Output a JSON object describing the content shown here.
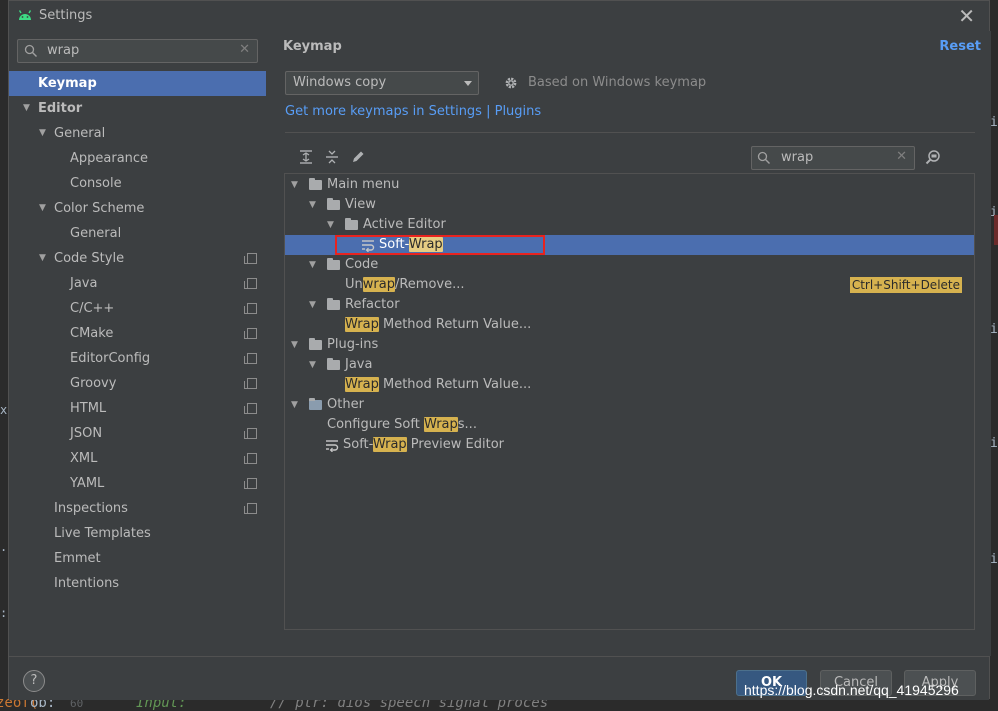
{
  "window": {
    "title": "Settings"
  },
  "left": {
    "search": {
      "value": "wrap"
    },
    "tree": [
      {
        "label": "Keymap",
        "level": 0,
        "selected": true,
        "bold": true,
        "arrow": false,
        "copy": false
      },
      {
        "label": "Editor",
        "level": 0,
        "bold": true,
        "arrow": true,
        "copy": false
      },
      {
        "label": "General",
        "level": 1,
        "arrow": true,
        "copy": false
      },
      {
        "label": "Appearance",
        "level": 2,
        "arrow": false,
        "copy": false
      },
      {
        "label": "Console",
        "level": 2,
        "arrow": false,
        "copy": false
      },
      {
        "label": "Color Scheme",
        "level": 1,
        "arrow": true,
        "copy": false
      },
      {
        "label": "General",
        "level": 2,
        "arrow": false,
        "copy": false
      },
      {
        "label": "Code Style",
        "level": 1,
        "arrow": true,
        "copy": true
      },
      {
        "label": "Java",
        "level": 2,
        "arrow": false,
        "copy": true
      },
      {
        "label": "C/C++",
        "level": 2,
        "arrow": false,
        "copy": true
      },
      {
        "label": "CMake",
        "level": 2,
        "arrow": false,
        "copy": true
      },
      {
        "label": "EditorConfig",
        "level": 2,
        "arrow": false,
        "copy": true
      },
      {
        "label": "Groovy",
        "level": 2,
        "arrow": false,
        "copy": true
      },
      {
        "label": "HTML",
        "level": 2,
        "arrow": false,
        "copy": true
      },
      {
        "label": "JSON",
        "level": 2,
        "arrow": false,
        "copy": true
      },
      {
        "label": "XML",
        "level": 2,
        "arrow": false,
        "copy": true
      },
      {
        "label": "YAML",
        "level": 2,
        "arrow": false,
        "copy": true
      },
      {
        "label": "Inspections",
        "level": 1,
        "arrow": false,
        "copy": true
      },
      {
        "label": "Live Templates",
        "level": 1,
        "arrow": false,
        "copy": false
      },
      {
        "label": "Emmet",
        "level": 1,
        "arrow": false,
        "copy": false
      },
      {
        "label": "Intentions",
        "level": 1,
        "arrow": false,
        "copy": false
      }
    ]
  },
  "right": {
    "title": "Keymap",
    "reset_label": "Reset",
    "keymap_select": "Windows copy",
    "based_on": "Based on Windows keymap",
    "get_more_link": "Get more keymaps in Settings | Plugins",
    "search": {
      "value": "wrap"
    },
    "actions": [
      {
        "level": 0,
        "arrow": true,
        "icon": "menu-folder",
        "parts": [
          {
            "t": "Main menu"
          }
        ]
      },
      {
        "level": 1,
        "arrow": true,
        "icon": "folder",
        "parts": [
          {
            "t": "View"
          }
        ]
      },
      {
        "level": 2,
        "arrow": true,
        "icon": "folder",
        "parts": [
          {
            "t": "Active Editor"
          }
        ]
      },
      {
        "level": 3,
        "arrow": false,
        "icon": "wrap",
        "selected": true,
        "parts": [
          {
            "t": "Soft-"
          },
          {
            "t": "Wrap",
            "hl": true
          }
        ]
      },
      {
        "level": 1,
        "arrow": true,
        "icon": "folder",
        "parts": [
          {
            "t": "Code"
          }
        ]
      },
      {
        "level": 2,
        "arrow": false,
        "icon": "",
        "parts": [
          {
            "t": "Un"
          },
          {
            "t": "wrap",
            "hl": true
          },
          {
            "t": "/Remove..."
          }
        ],
        "shortcut": "Ctrl+Shift+Delete"
      },
      {
        "level": 1,
        "arrow": true,
        "icon": "folder",
        "parts": [
          {
            "t": "Refactor"
          }
        ]
      },
      {
        "level": 2,
        "arrow": false,
        "icon": "",
        "parts": [
          {
            "t": "Wrap",
            "hl": true
          },
          {
            "t": " Method Return Value..."
          }
        ]
      },
      {
        "level": 0,
        "arrow": true,
        "icon": "folder",
        "parts": [
          {
            "t": "Plug-ins"
          }
        ]
      },
      {
        "level": 1,
        "arrow": true,
        "icon": "folder",
        "parts": [
          {
            "t": "Java"
          }
        ]
      },
      {
        "level": 2,
        "arrow": false,
        "icon": "",
        "parts": [
          {
            "t": "Wrap",
            "hl": true
          },
          {
            "t": " Method Return Value..."
          }
        ]
      },
      {
        "level": 0,
        "arrow": true,
        "icon": "other-folder",
        "parts": [
          {
            "t": "Other"
          }
        ]
      },
      {
        "level": 1,
        "arrow": false,
        "icon": "",
        "parts": [
          {
            "t": "Configure Soft "
          },
          {
            "t": "Wrap",
            "hl": true
          },
          {
            "t": "s..."
          }
        ]
      },
      {
        "level": 1,
        "arrow": false,
        "icon": "wrap",
        "parts": [
          {
            "t": "Soft-"
          },
          {
            "t": "Wrap",
            "hl": true
          },
          {
            "t": " Preview Editor"
          }
        ]
      }
    ]
  },
  "buttons": {
    "ok": "OK",
    "cancel": "Cancel",
    "apply": "Apply",
    "help": "?"
  },
  "watermark": "https://blog.csdn.net/qq_41945296",
  "background": {
    "code_a": "zeof(",
    "code_b": "ob:",
    "line_number": "60",
    "code_c": "Input:",
    "code_d": "// ptr: dios speech signal proces"
  },
  "colors": {
    "accent": "#4b6eaf",
    "link": "#589df6",
    "highlight": "#d6b24f",
    "annotation_box": "#e8231f"
  }
}
